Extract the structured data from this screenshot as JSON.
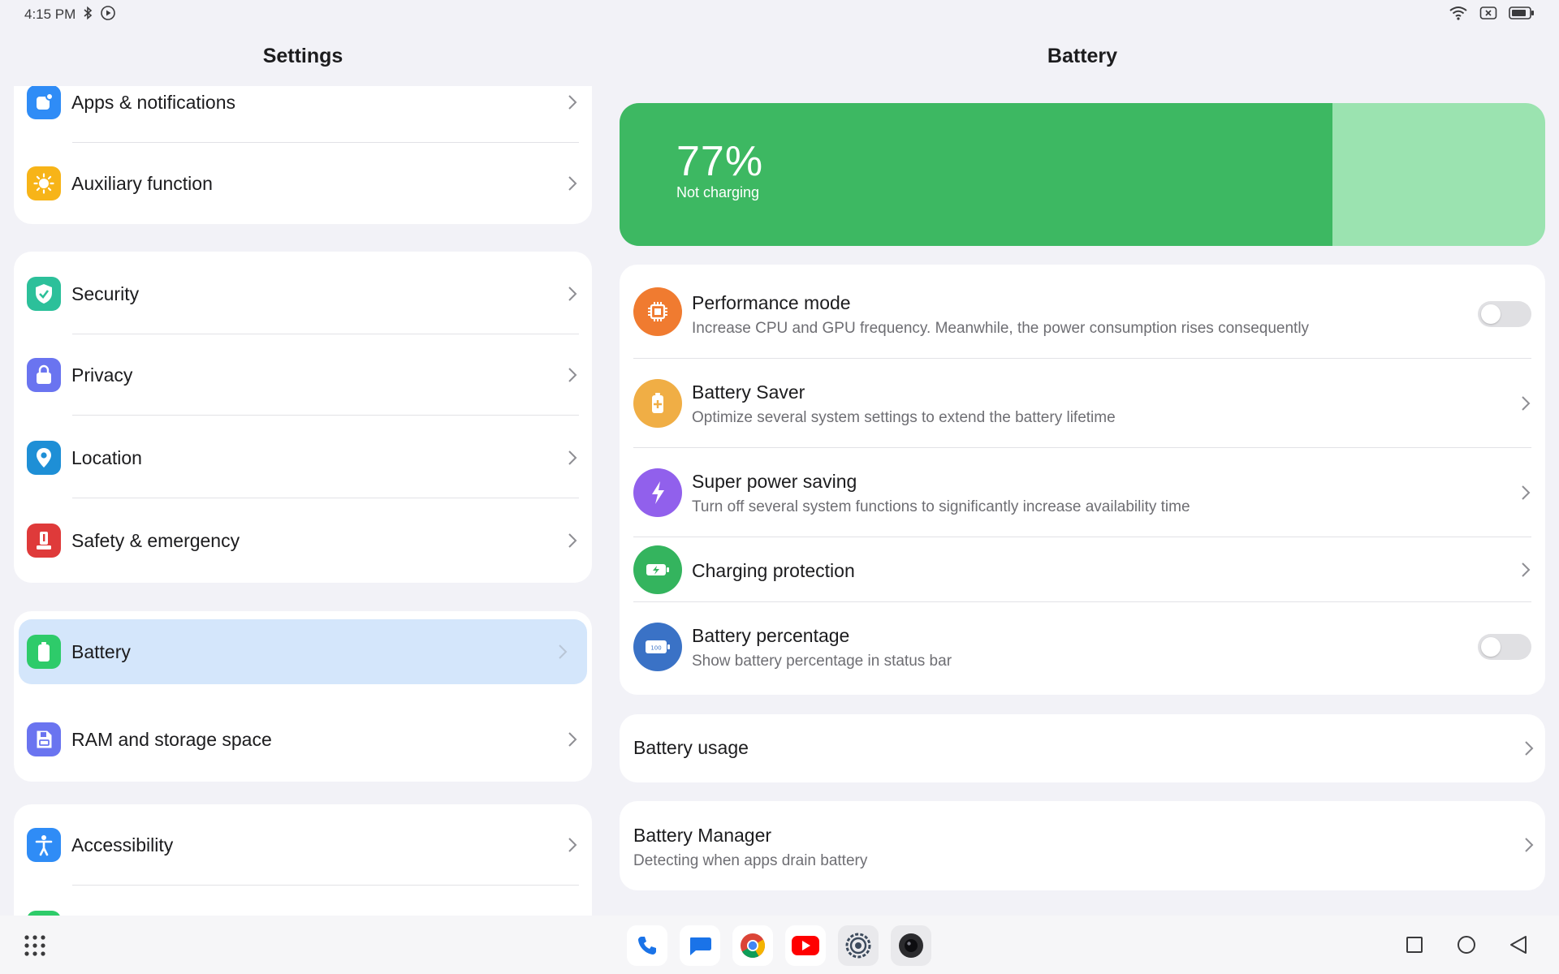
{
  "status_bar": {
    "time": "4:15 PM"
  },
  "left": {
    "title": "Settings",
    "groups": [
      {
        "items": [
          {
            "label": "Apps & notifications",
            "icon": "apps-icon",
            "color": "#2f8cf6"
          },
          {
            "label": "Auxiliary function",
            "icon": "sun-icon",
            "color": "#f7b418"
          }
        ]
      },
      {
        "items": [
          {
            "label": "Security",
            "icon": "shield-check-icon",
            "color": "#2cc09a"
          },
          {
            "label": "Privacy",
            "icon": "lock-icon",
            "color": "#6a74f0"
          },
          {
            "label": "Location",
            "icon": "location-pin-icon",
            "color": "#1e8fd6"
          },
          {
            "label": "Safety & emergency",
            "icon": "emergency-icon",
            "color": "#df3a3a"
          }
        ]
      },
      {
        "items": [
          {
            "label": "Battery",
            "icon": "battery-icon",
            "color": "#2ecb6a",
            "selected": true
          },
          {
            "label": "RAM and storage space",
            "icon": "storage-icon",
            "color": "#6a74f0"
          }
        ]
      },
      {
        "items": [
          {
            "label": "Accessibility",
            "icon": "accessibility-icon",
            "color": "#2f8cf6"
          }
        ]
      }
    ]
  },
  "right": {
    "title": "Battery",
    "battery": {
      "percent_text": "77%",
      "level": 77,
      "status": "Not charging",
      "fill_color": "#3db862",
      "track_color": "#9be3b0"
    },
    "options": [
      {
        "title": "Performance mode",
        "subtitle": "Increase CPU and GPU frequency. Meanwhile, the power consumption rises consequently",
        "icon": "chip-icon",
        "color": "#f07b30",
        "control": "toggle",
        "on": false
      },
      {
        "title": "Battery Saver",
        "subtitle": "Optimize several system settings to extend the battery lifetime",
        "icon": "battery-plus-icon",
        "color": "#f0ae45",
        "control": "chevron"
      },
      {
        "title": "Super power saving",
        "subtitle": "Turn off several system functions to significantly increase availability time",
        "icon": "lightning-icon",
        "color": "#9160ec",
        "control": "chevron"
      },
      {
        "title": "Charging protection",
        "subtitle": "",
        "icon": "battery-bolt-icon",
        "color": "#34b45e",
        "control": "chevron"
      },
      {
        "title": "Battery percentage",
        "subtitle": "Show battery percentage in status bar",
        "icon": "battery-percent-icon",
        "color": "#3a72c6",
        "control": "toggle",
        "on": false,
        "icon_text": "100"
      }
    ],
    "usage": {
      "title": "Battery usage"
    },
    "manager": {
      "title": "Battery Manager",
      "subtitle": "Detecting when apps drain battery"
    }
  },
  "dock": {
    "apps": [
      "phone-app-icon",
      "messages-app-icon",
      "chrome-app-icon",
      "youtube-app-icon",
      "settings-app-icon",
      "camera-app-icon"
    ]
  }
}
